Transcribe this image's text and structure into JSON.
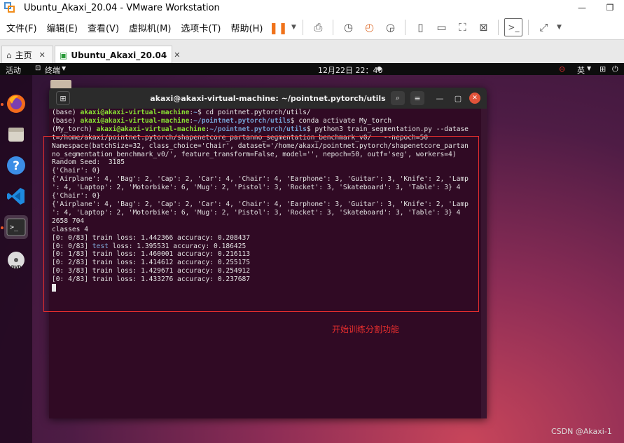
{
  "window": {
    "title": "Ubuntu_Akaxi_20.04 - VMware Workstation"
  },
  "menu": {
    "items": [
      "文件(F)",
      "编辑(E)",
      "查看(V)",
      "虚拟机(M)",
      "选项卡(T)",
      "帮助(H)"
    ]
  },
  "tabs": [
    {
      "label": "主页"
    },
    {
      "label": "Ubuntu_Akaxi_20.04"
    }
  ],
  "ubuntu": {
    "activities": "活动",
    "app_menu": "终端",
    "clock": "12月22日  22：40",
    "input_method": "英"
  },
  "terminal": {
    "title": "akaxi@akaxi-virtual-machine: ~/pointnet.pytorch/utils",
    "lines": [
      {
        "pre": "(base) ",
        "user": "akaxi@akaxi-virtual-machine",
        "sep": ":",
        "path": "~",
        "cmd": "$ cd pointnet.pytorch/utils/"
      },
      {
        "pre": "(base) ",
        "user": "akaxi@akaxi-virtual-machine",
        "sep": ":",
        "path": "~/pointnet.pytorch/utils",
        "cmd": "$ conda activate My_torch"
      },
      {
        "pre": "(My_torch) ",
        "user": "akaxi@akaxi-virtual-machine",
        "sep": ":",
        "path": "~/pointnet.pytorch/utils",
        "cmd": "$ python3 train_segmentation.py --datase"
      }
    ],
    "output": [
      "t=/home/akaxi/pointnet.pytorch/shapenetcore_partanno_segmentation_benchmark_v0/   --nepoch=50",
      "Namespace(batchSize=32, class_choice='Chair', dataset='/home/akaxi/pointnet.pytorch/shapenetcore_partan",
      "no_segmentation_benchmark_v0/', feature_transform=False, model='', nepoch=50, outf='seg', workers=4)",
      "Random Seed:  3185",
      "{'Chair': 0}",
      "{'Airplane': 4, 'Bag': 2, 'Cap': 2, 'Car': 4, 'Chair': 4, 'Earphone': 3, 'Guitar': 3, 'Knife': 2, 'Lamp",
      "': 4, 'Laptop': 2, 'Motorbike': 6, 'Mug': 2, 'Pistol': 3, 'Rocket': 3, 'Skateboard': 3, 'Table': 3} 4",
      "{'Chair': 0}",
      "{'Airplane': 4, 'Bag': 2, 'Cap': 2, 'Car': 4, 'Chair': 4, 'Earphone': 3, 'Guitar': 3, 'Knife': 2, 'Lamp",
      "': 4, 'Laptop': 2, 'Motorbike': 6, 'Mug': 2, 'Pistol': 3, 'Rocket': 3, 'Skateboard': 3, 'Table': 3} 4",
      "2658 704",
      "classes 4",
      "[0: 0/83] train loss: 1.442366 accuracy: 0.208437"
    ],
    "test_line": {
      "pre": "[0: 0/83] ",
      "kw": "test",
      "post": " loss: 1.395531 accuracy: 0.186425"
    },
    "output2": [
      "[0: 1/83] train loss: 1.460001 accuracy: 0.216113",
      "[0: 2/83] train loss: 1.414612 accuracy: 0.255175",
      "[0: 3/83] train loss: 1.429671 accuracy: 0.254912",
      "[0: 4/83] train loss: 1.433276 accuracy: 0.237687"
    ]
  },
  "annotation": {
    "text": "开始训练分割功能",
    "color": "#e62e2e"
  },
  "watermark": "CSDN @Akaxi-1",
  "colors": {
    "terminal_bg": "#300a24",
    "prompt_user": "#8ae234",
    "prompt_path": "#729fcf"
  }
}
